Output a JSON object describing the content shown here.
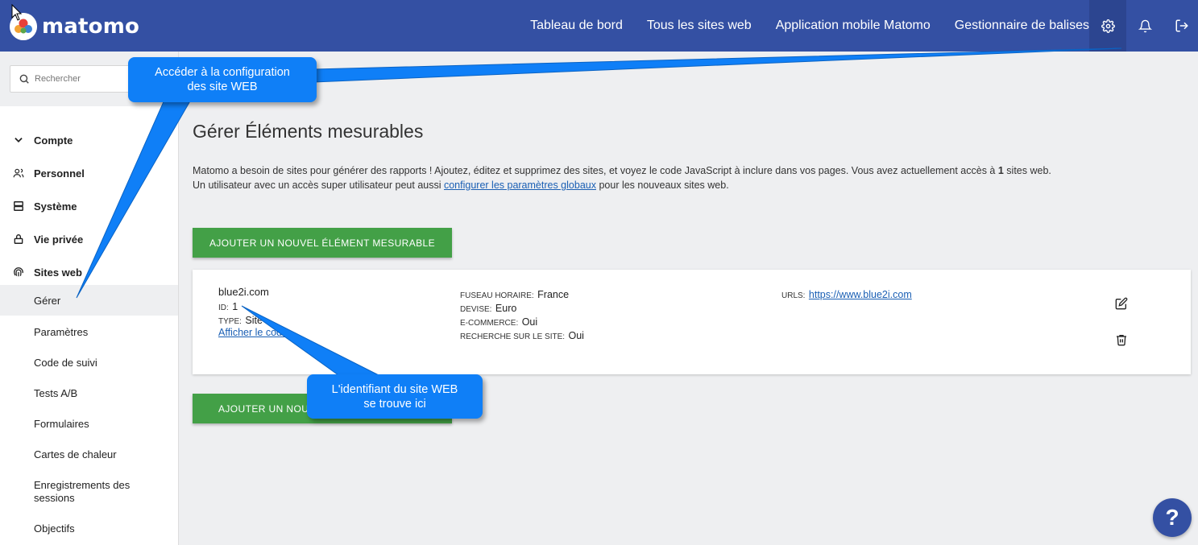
{
  "app": {
    "brand": "matomo",
    "colors": {
      "header": "#3450a3",
      "accent_green": "#43a047",
      "callout": "#0f7ff7",
      "link": "#1a5fb4"
    }
  },
  "topnav": {
    "items": [
      "Tableau de bord",
      "Tous les sites web",
      "Application mobile Matomo",
      "Gestionnaire de balises"
    ],
    "icons": [
      "gear-icon",
      "bell-icon",
      "logout-icon"
    ]
  },
  "search": {
    "placeholder": "Rechercher"
  },
  "sidebar": {
    "categories": [
      {
        "label": "Compte",
        "icon": "chevron-down-icon"
      },
      {
        "label": "Personnel",
        "icon": "people-icon"
      },
      {
        "label": "Système",
        "icon": "server-icon"
      },
      {
        "label": "Vie privée",
        "icon": "lock-icon"
      },
      {
        "label": "Sites web",
        "icon": "fingerprint-icon"
      }
    ],
    "subitems": [
      "Gérer",
      "Paramètres",
      "Code de suivi",
      "Tests A/B",
      "Formulaires",
      "Cartes de chaleur",
      "Enregistrements des sessions",
      "Objectifs"
    ],
    "active_subitem": "Gérer"
  },
  "main": {
    "title": "Gérer Éléments mesurables",
    "intro_part1": "Matomo a besoin de sites pour générer des rapports ! Ajoutez, éditez et supprimez des sites, et voyez le code JavaScript à inclure dans vos pages. Vous avez actuellement accès à ",
    "intro_count": "1",
    "intro_part2": " sites web.",
    "intro_line2_before": "Un utilisateur avec un accès super utilisateur peut aussi ",
    "intro_link": "configurer les paramètres globaux",
    "intro_line2_after": " pour les nouveaux sites web.",
    "add_button": "AJOUTER UN NOUVEL ÉLÉMENT MESURABLE",
    "add_button_bottom_visible": "AJOUTER UN NOUV"
  },
  "site": {
    "name": "blue2i.com",
    "id_label": "ID:",
    "id_value": "1",
    "type_label": "TYPE:",
    "type_value": "Site",
    "show_code_link": "Afficher le code",
    "timezone_label": "FUSEAU HORAIRE:",
    "timezone_value": "France",
    "currency_label": "DEVISE:",
    "currency_value": "Euro",
    "ecommerce_label": "E-COMMERCE:",
    "ecommerce_value": "Oui",
    "sitesearch_label": "RECHERCHE SUR LE SITE:",
    "sitesearch_value": "Oui",
    "urls_label": "URLS:",
    "urls_value": "https://www.blue2i.com",
    "icons": [
      "edit-icon",
      "trash-icon"
    ]
  },
  "callouts": [
    {
      "line1": "Accéder à la configuration",
      "line2": "des site WEB"
    },
    {
      "line1": "L'identifiant du site WEB",
      "line2": "se trouve ici"
    }
  ],
  "help": {
    "label": "?"
  }
}
